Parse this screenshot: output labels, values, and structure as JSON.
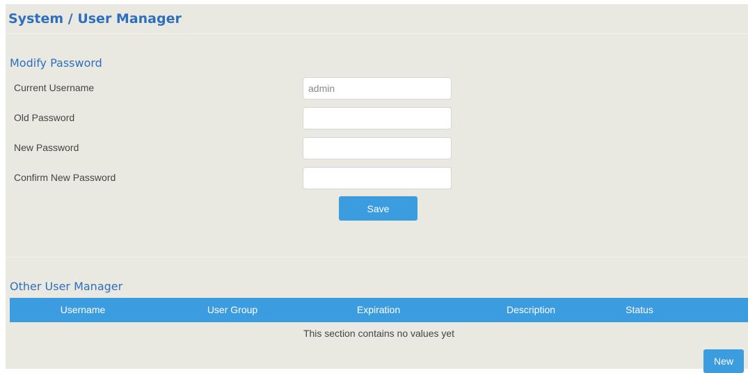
{
  "page": {
    "title": "System / User Manager"
  },
  "modify_password": {
    "title": "Modify Password",
    "fields": [
      {
        "label": "Current Username",
        "value": "admin"
      },
      {
        "label": "Old Password",
        "value": ""
      },
      {
        "label": "New Password",
        "value": ""
      },
      {
        "label": "Confirm New Password",
        "value": ""
      }
    ],
    "save_label": "Save"
  },
  "other_users": {
    "title": "Other User Manager",
    "columns": [
      "Username",
      "User Group",
      "Expiration",
      "Description",
      "Status"
    ],
    "empty_message": "This section contains no values yet",
    "new_label": "New"
  },
  "colors": {
    "accent": "#3b9ce0",
    "heading": "#2d6fbf",
    "panel_background": "#eae9e1"
  }
}
